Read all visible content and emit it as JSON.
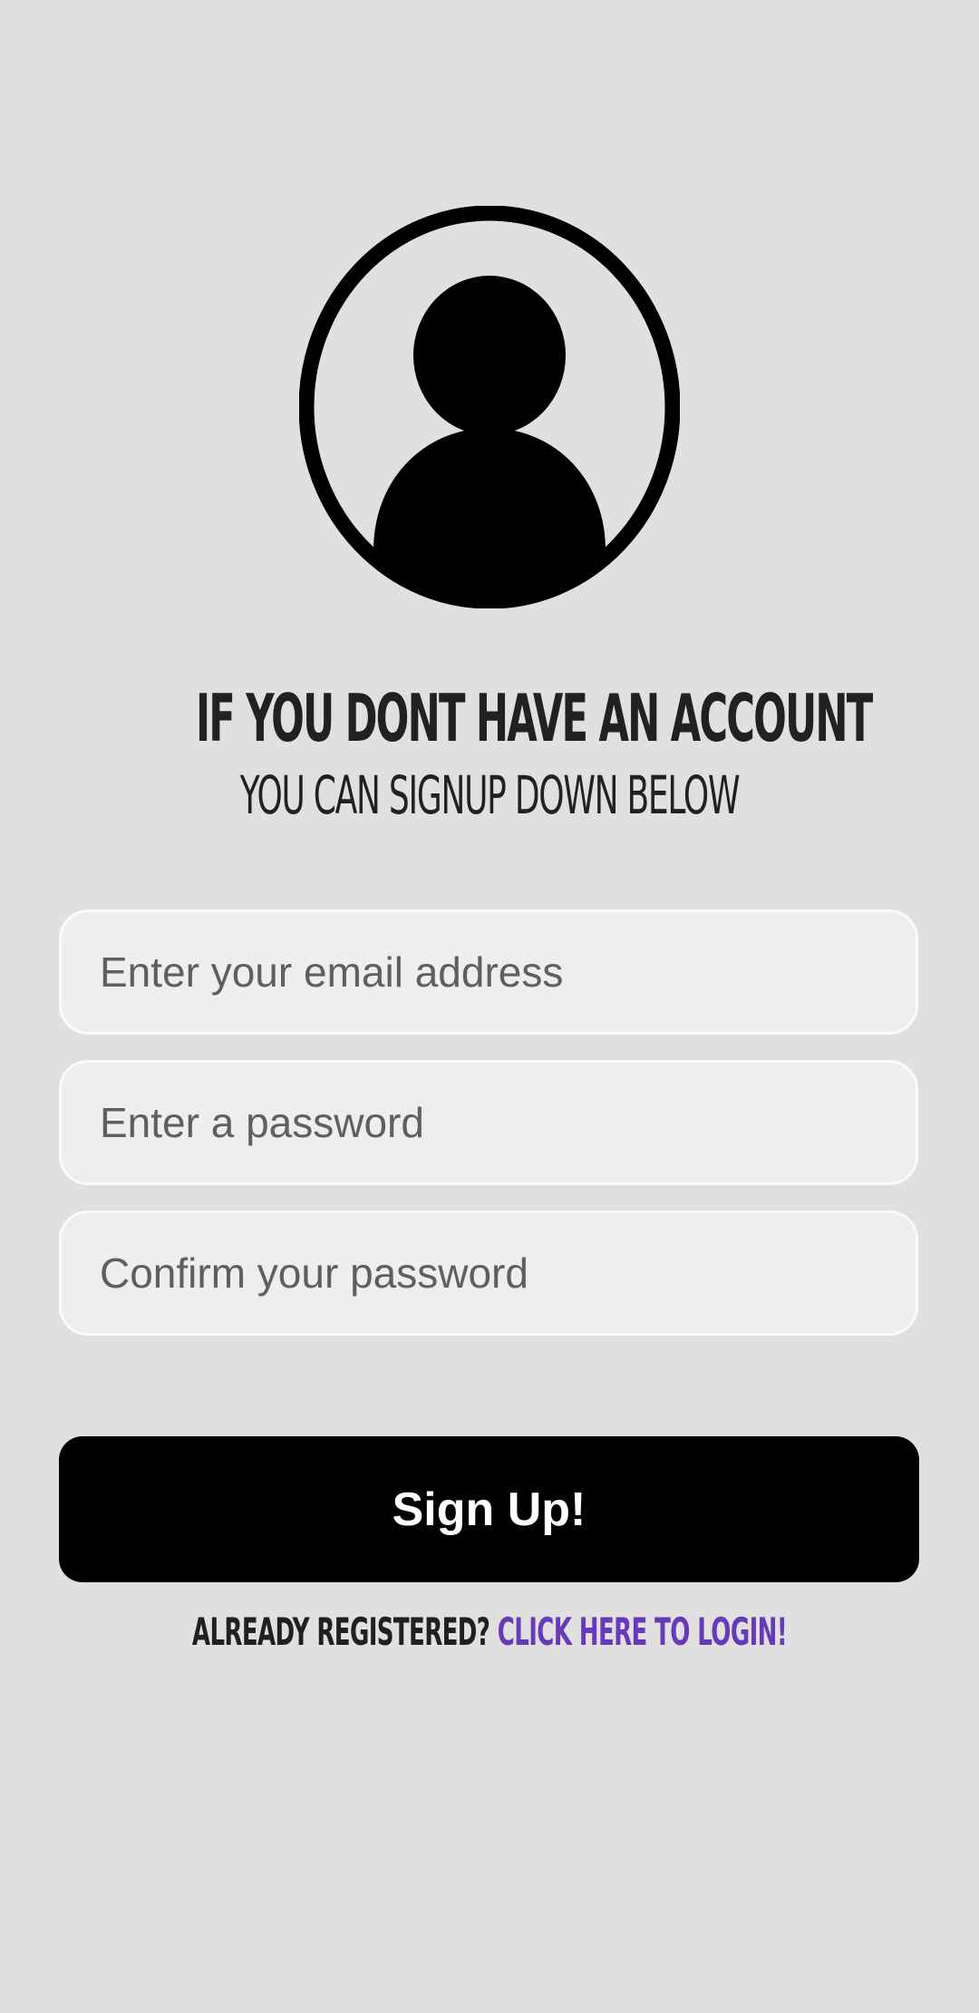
{
  "avatar": {
    "icon": "account-circle-icon",
    "color": "#000000"
  },
  "heading": {
    "line1": "IF YOU DONT HAVE AN ACCOUNT",
    "line2": "YOU CAN SIGNUP DOWN BELOW"
  },
  "form": {
    "email_placeholder": "Enter your email address",
    "password_placeholder": "Enter a password",
    "confirm_placeholder": "Confirm your password",
    "submit_label": "Sign Up!"
  },
  "footer": {
    "prompt": "ALREADY REGISTERED? ",
    "link_text": "CLICK HERE TO LOGIN!",
    "link_color": "#673ab7"
  },
  "colors": {
    "background": "#e0e0e0",
    "field_background": "#eeeeee",
    "button_background": "#000000",
    "button_text": "#ffffff",
    "heading_text": "#212121"
  }
}
